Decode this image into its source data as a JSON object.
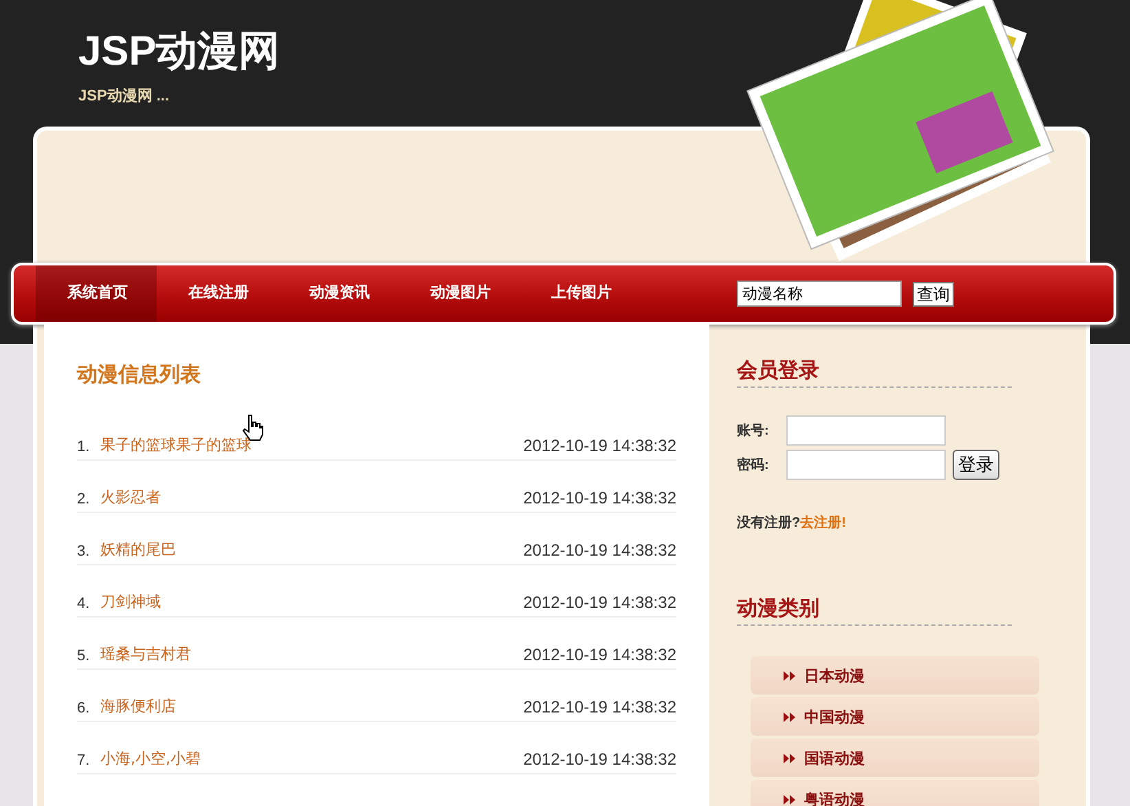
{
  "header": {
    "title": "JSP动漫网",
    "subtitle": "JSP动漫网 ..."
  },
  "nav": {
    "items": [
      {
        "label": "系统首页",
        "selected": true
      },
      {
        "label": "在线注册",
        "selected": false
      },
      {
        "label": "动漫资讯",
        "selected": false
      },
      {
        "label": "动漫图片",
        "selected": false
      },
      {
        "label": "上传图片",
        "selected": false
      }
    ],
    "search": {
      "value": "动漫名称",
      "button": "查询"
    }
  },
  "news": {
    "heading": "动漫信息列表",
    "items": [
      {
        "number": "1.",
        "title": "果子的篮球果子的篮球",
        "date": "2012-10-19 14:38:32"
      },
      {
        "number": "2.",
        "title": "火影忍者",
        "date": "2012-10-19 14:38:32"
      },
      {
        "number": "3.",
        "title": "妖精的尾巴",
        "date": "2012-10-19 14:38:32"
      },
      {
        "number": "4.",
        "title": "刀剑神域",
        "date": "2012-10-19 14:38:32"
      },
      {
        "number": "5.",
        "title": "瑶桑与吉村君",
        "date": "2012-10-19 14:38:32"
      },
      {
        "number": "6.",
        "title": "海豚便利店",
        "date": "2012-10-19 14:38:32"
      },
      {
        "number": "7.",
        "title": "小海,小空,小碧",
        "date": "2012-10-19 14:38:32"
      }
    ]
  },
  "login": {
    "heading": "会员登录",
    "fields": [
      {
        "label": "账号:"
      },
      {
        "label": "密码:"
      }
    ],
    "button": "登录",
    "register_prompt": "没有注册?",
    "register_link": "去注册!"
  },
  "categories": {
    "heading": "动漫类别",
    "items": [
      {
        "label": "日本动漫"
      },
      {
        "label": "中国动漫"
      },
      {
        "label": "国语动漫"
      },
      {
        "label": "粤语动漫"
      }
    ]
  }
}
